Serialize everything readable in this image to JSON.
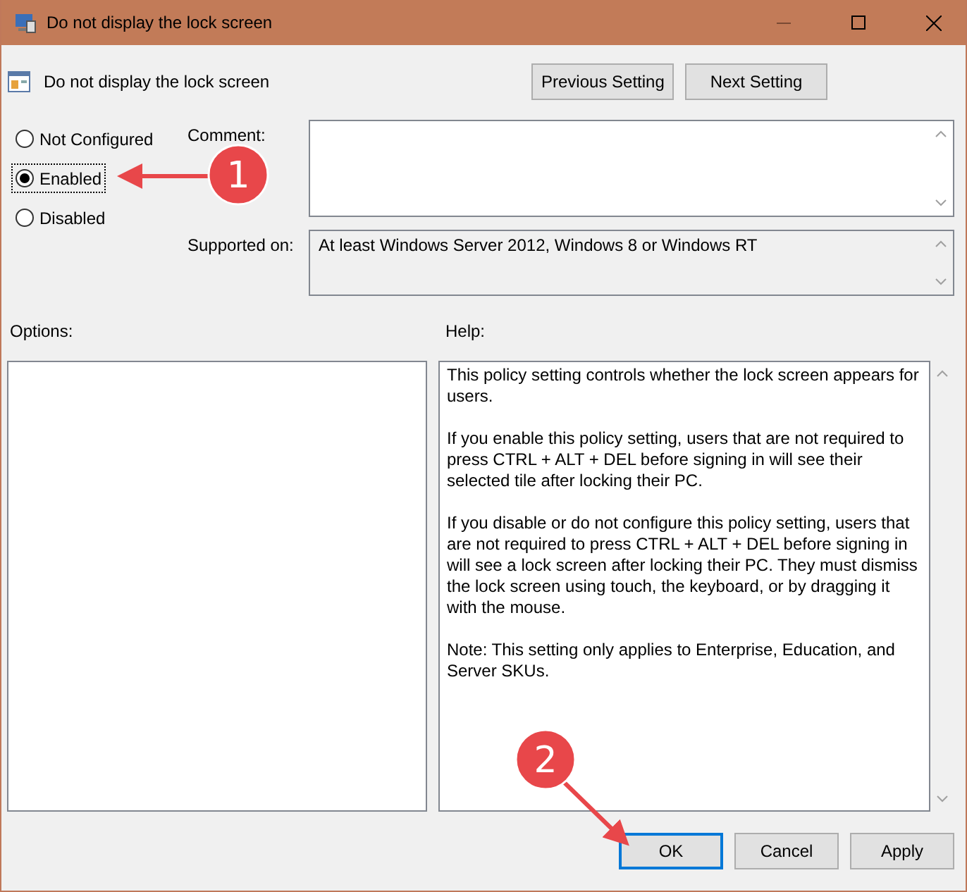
{
  "window": {
    "title": "Do not display the lock screen"
  },
  "header": {
    "policy_name": "Do not display the lock screen",
    "buttons": [
      "Previous Setting",
      "Next Setting"
    ]
  },
  "radios": [
    {
      "label": "Not Configured",
      "selected": false,
      "focused": false
    },
    {
      "label": "Enabled",
      "selected": true,
      "focused": true
    },
    {
      "label": "Disabled",
      "selected": false,
      "focused": false
    }
  ],
  "comment": {
    "label": "Comment:"
  },
  "supported_on": {
    "label": "Supported on:",
    "value": "At least Windows Server 2012, Windows 8 or Windows RT"
  },
  "options": {
    "label": "Options:"
  },
  "help": {
    "label": "Help:",
    "paragraphs": [
      "This policy setting controls whether the lock screen appears for users.",
      "If you enable this policy setting, users that are not required to press CTRL + ALT + DEL before signing in will see their selected tile after locking their PC.",
      "If you disable or do not configure this policy setting, users that are not required to press CTRL + ALT + DEL before signing in will see a lock screen after locking their PC. They must dismiss the lock screen using touch, the keyboard, or by dragging it with the mouse.",
      "Note: This setting only applies to Enterprise, Education, and Server SKUs."
    ]
  },
  "footer_buttons": [
    {
      "label": "OK",
      "selected": true
    },
    {
      "label": "Cancel",
      "selected": false
    },
    {
      "label": "Apply",
      "selected": false
    }
  ],
  "annotations": [
    "1",
    "2"
  ]
}
